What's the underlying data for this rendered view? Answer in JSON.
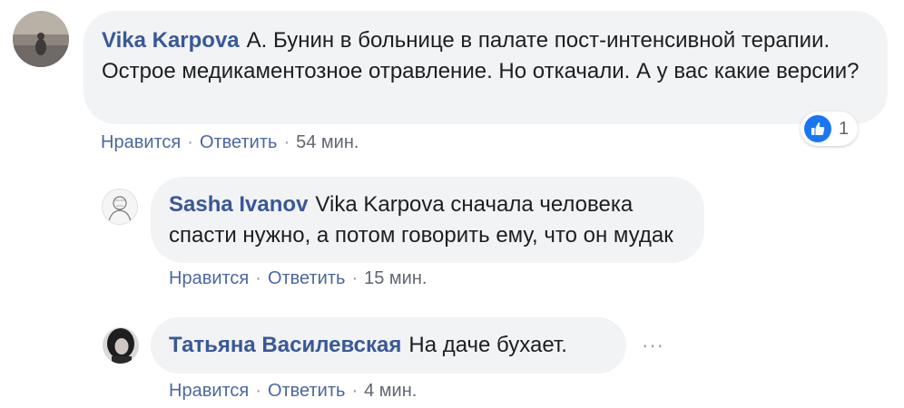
{
  "comments": [
    {
      "author": "Vika Karpova",
      "text": "А. Бунин в больнице в палате пост-интенсивной терапии. Острое медикаментозное отравление. Но откачали. А у вас какие версии?",
      "like_label": "Нравится",
      "reply_label": "Ответить",
      "time": "54 мин.",
      "reaction_count": "1",
      "reaction_icon": "like-icon"
    },
    {
      "author": "Sasha Ivanov",
      "text": "Vika Karpova сначала человека спасти нужно, а потом говорить ему, что он мудак",
      "like_label": "Нравится",
      "reply_label": "Ответить",
      "time": "15 мин."
    },
    {
      "author": "Татьяна Василевская",
      "text": "На даче бухает.",
      "like_label": "Нравится",
      "reply_label": "Ответить",
      "time": "4 мин.",
      "more_label": "···"
    }
  ],
  "separator": "·",
  "colors": {
    "author": "#385898",
    "link": "#4b67a1",
    "bubble": "#f2f3f5",
    "like_blue": "#1877f2"
  }
}
